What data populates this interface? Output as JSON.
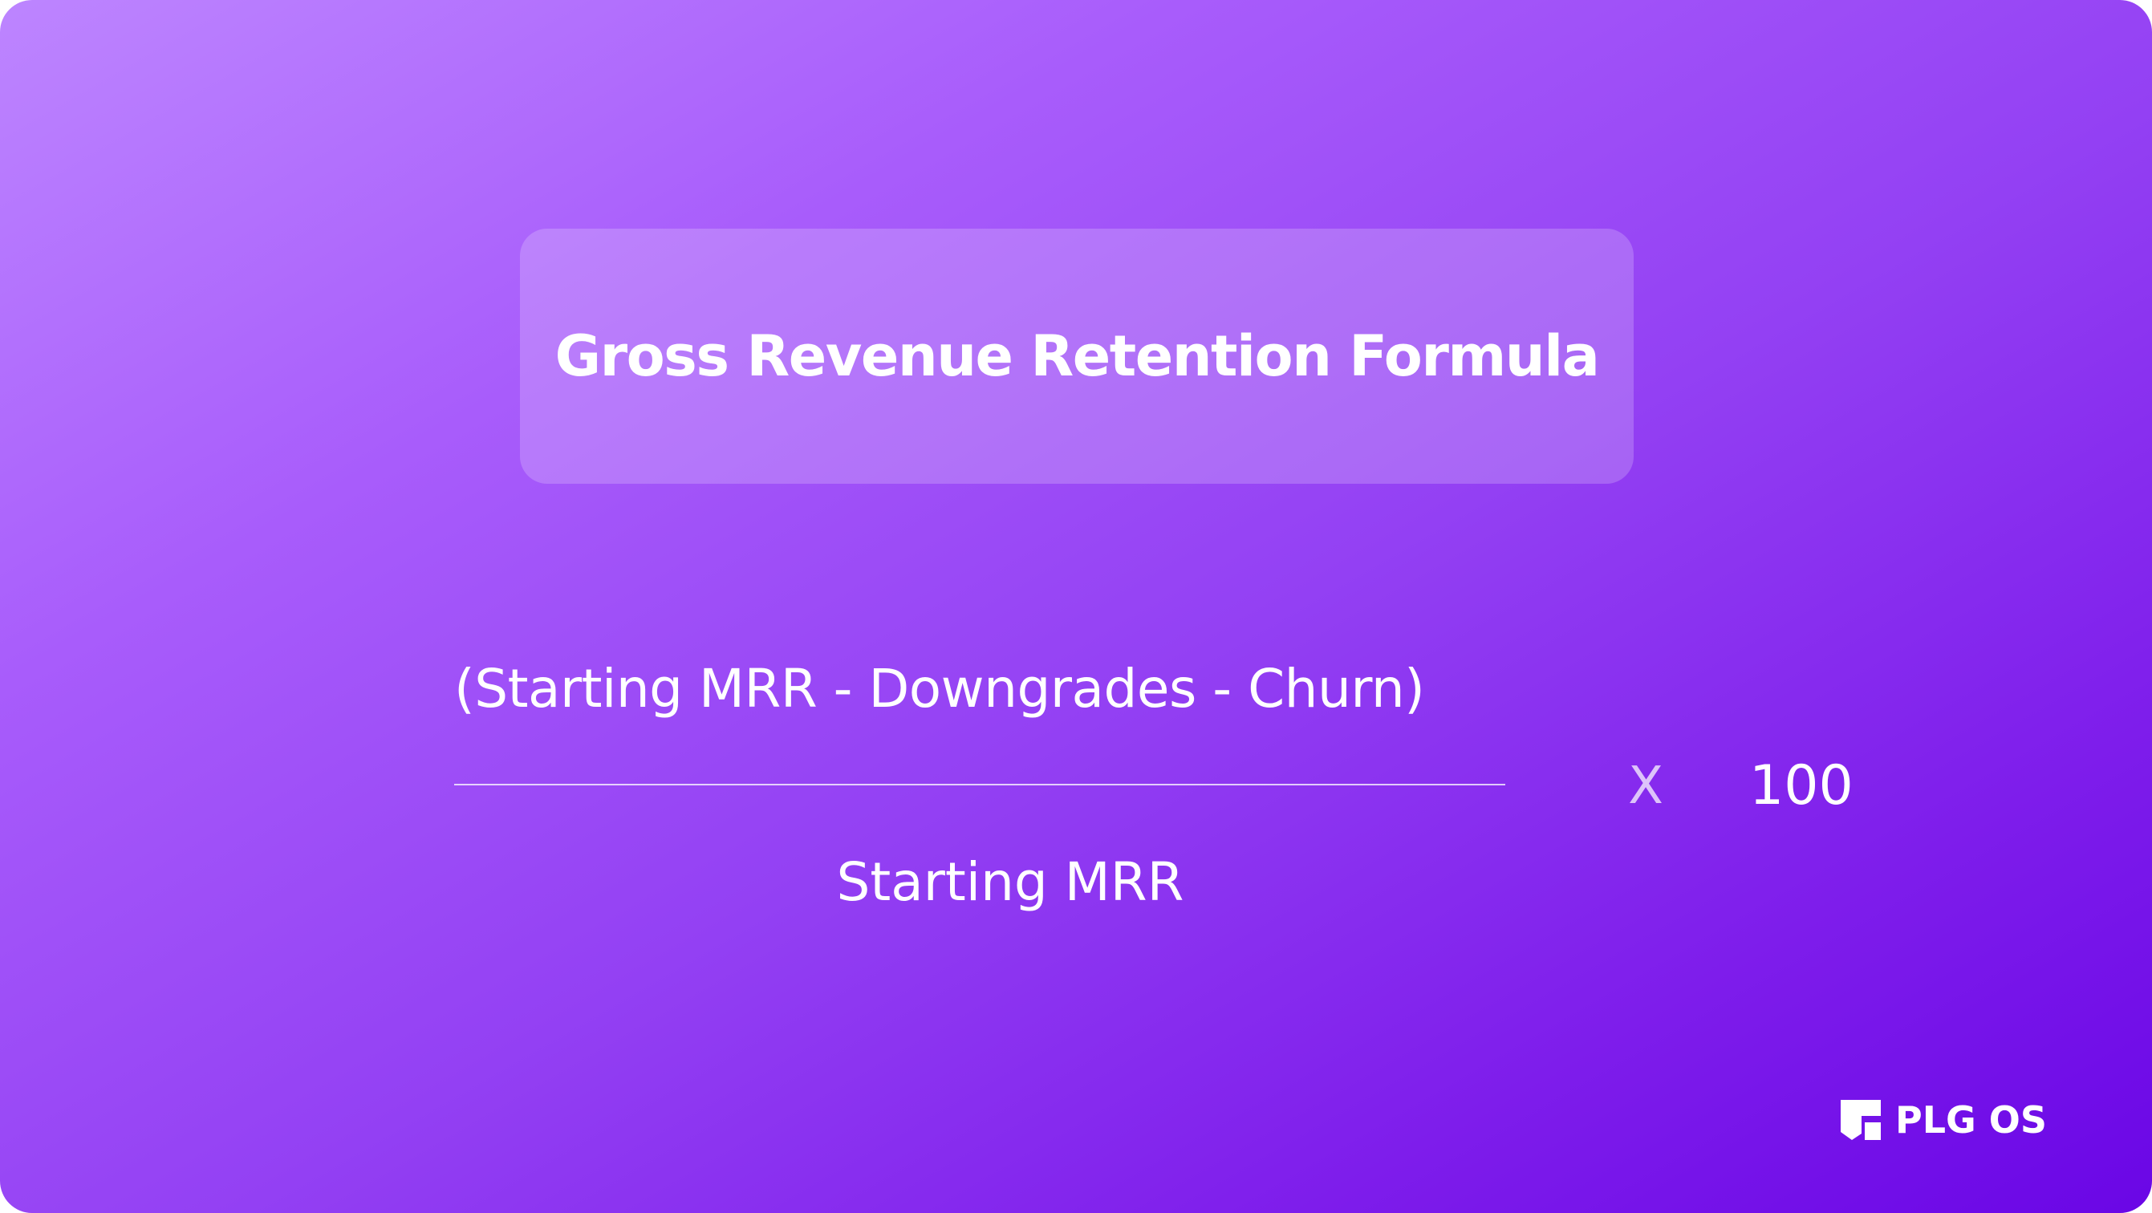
{
  "title": "Gross Revenue Retention Formula",
  "formula": {
    "numerator": "(Starting MRR - Downgrades - Churn)",
    "denominator": "Starting MRR",
    "operator": "X",
    "multiplier": "100"
  },
  "brand": {
    "name": "PLG OS",
    "icon": "plg-os-logo-icon"
  },
  "colors": {
    "gradient_start": "#bd85ff",
    "gradient_end": "#6a06e6",
    "text": "#ffffff"
  }
}
